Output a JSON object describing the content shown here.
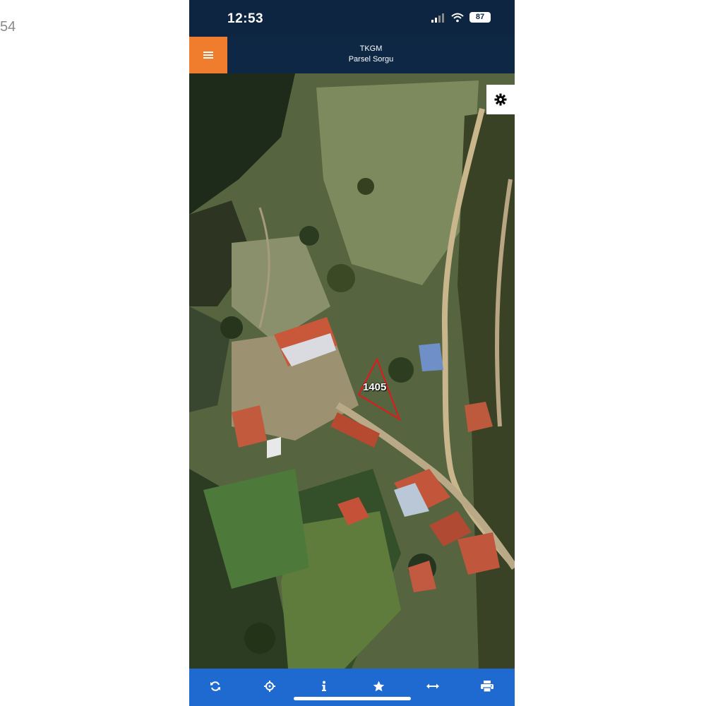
{
  "edge_text": "54",
  "status_bar": {
    "time": "12:53",
    "battery": "87"
  },
  "app_bar": {
    "title": "TKGM",
    "subtitle": "Parsel Sorgu"
  },
  "map": {
    "parcel_label": "1405"
  },
  "icons": {
    "menu": "hamburger-menu-icon",
    "settings": "gear-icon",
    "toolbar": [
      "refresh-icon",
      "locate-icon",
      "info-icon",
      "star-icon",
      "measure-icon",
      "print-icon"
    ]
  },
  "colors": {
    "header_bg": "#0d2540",
    "menu_button": "#f07c2e",
    "toolbar_bg": "#1f6ad0",
    "parcel_outline": "#e01a1a"
  }
}
